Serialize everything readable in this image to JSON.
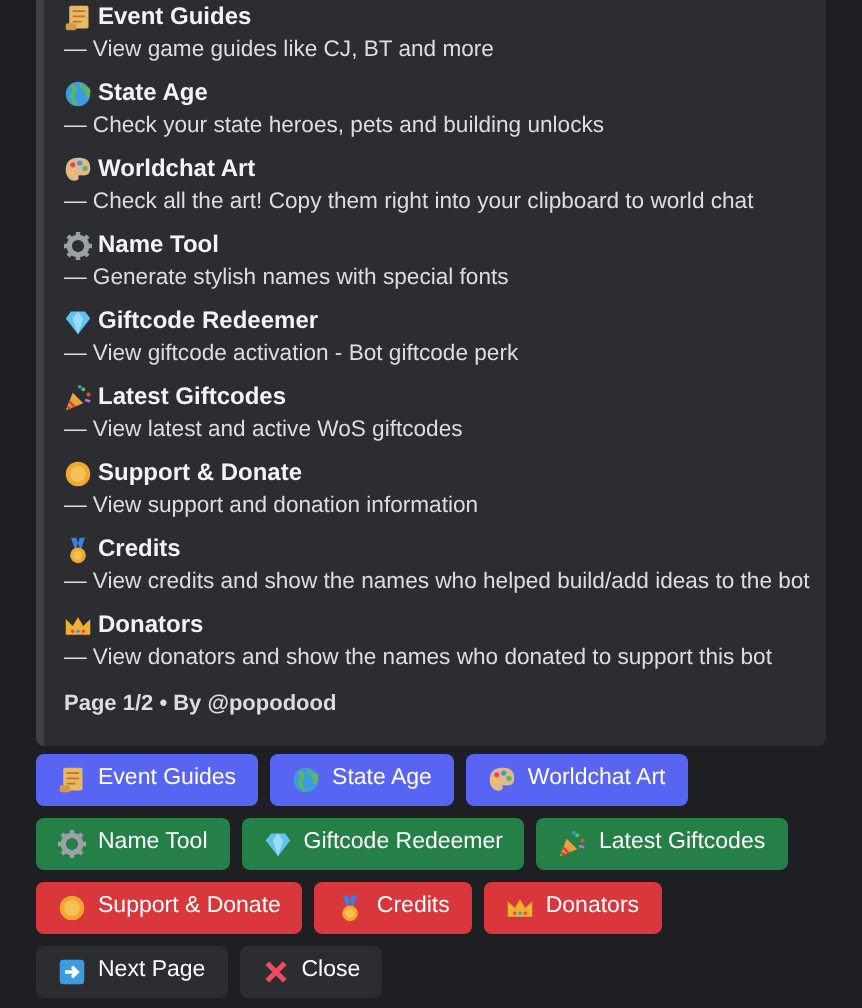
{
  "embed": {
    "items": [
      {
        "title": "Event Guides",
        "description": "— View game guides like CJ, BT and more"
      },
      {
        "title": "State Age",
        "description": "— Check your state heroes, pets and building unlocks"
      },
      {
        "title": "Worldchat Art",
        "description": "— Check all the art! Copy them right into your clipboard to world chat"
      },
      {
        "title": "Name Tool",
        "description": "— Generate stylish names with special fonts"
      },
      {
        "title": "Giftcode Redeemer",
        "description": "— View giftcode activation - Bot giftcode perk"
      },
      {
        "title": "Latest Giftcodes",
        "description": "— View latest and active WoS giftcodes"
      },
      {
        "title": "Support & Donate",
        "description": "— View support and donation information"
      },
      {
        "title": "Credits",
        "description": "— View credits and show the names who helped build/add ideas to the bot"
      },
      {
        "title": "Donators",
        "description": "— View donators and show the names who donated to support this bot"
      }
    ],
    "footer": "Page 1/2 • By @popodood"
  },
  "button_rows": [
    [
      {
        "label": "Event Guides",
        "kind": "primary"
      },
      {
        "label": "State Age",
        "kind": "primary"
      },
      {
        "label": "Worldchat Art",
        "kind": "primary"
      }
    ],
    [
      {
        "label": "Name Tool",
        "kind": "success"
      },
      {
        "label": "Giftcode Redeemer",
        "kind": "success"
      },
      {
        "label": "Latest Giftcodes",
        "kind": "success"
      }
    ],
    [
      {
        "label": "Support & Donate",
        "kind": "danger"
      },
      {
        "label": "Credits",
        "kind": "danger"
      },
      {
        "label": "Donators",
        "kind": "danger"
      }
    ],
    [
      {
        "label": "Next Page",
        "kind": "secondary"
      },
      {
        "label": "Close",
        "kind": "secondary"
      }
    ]
  ]
}
